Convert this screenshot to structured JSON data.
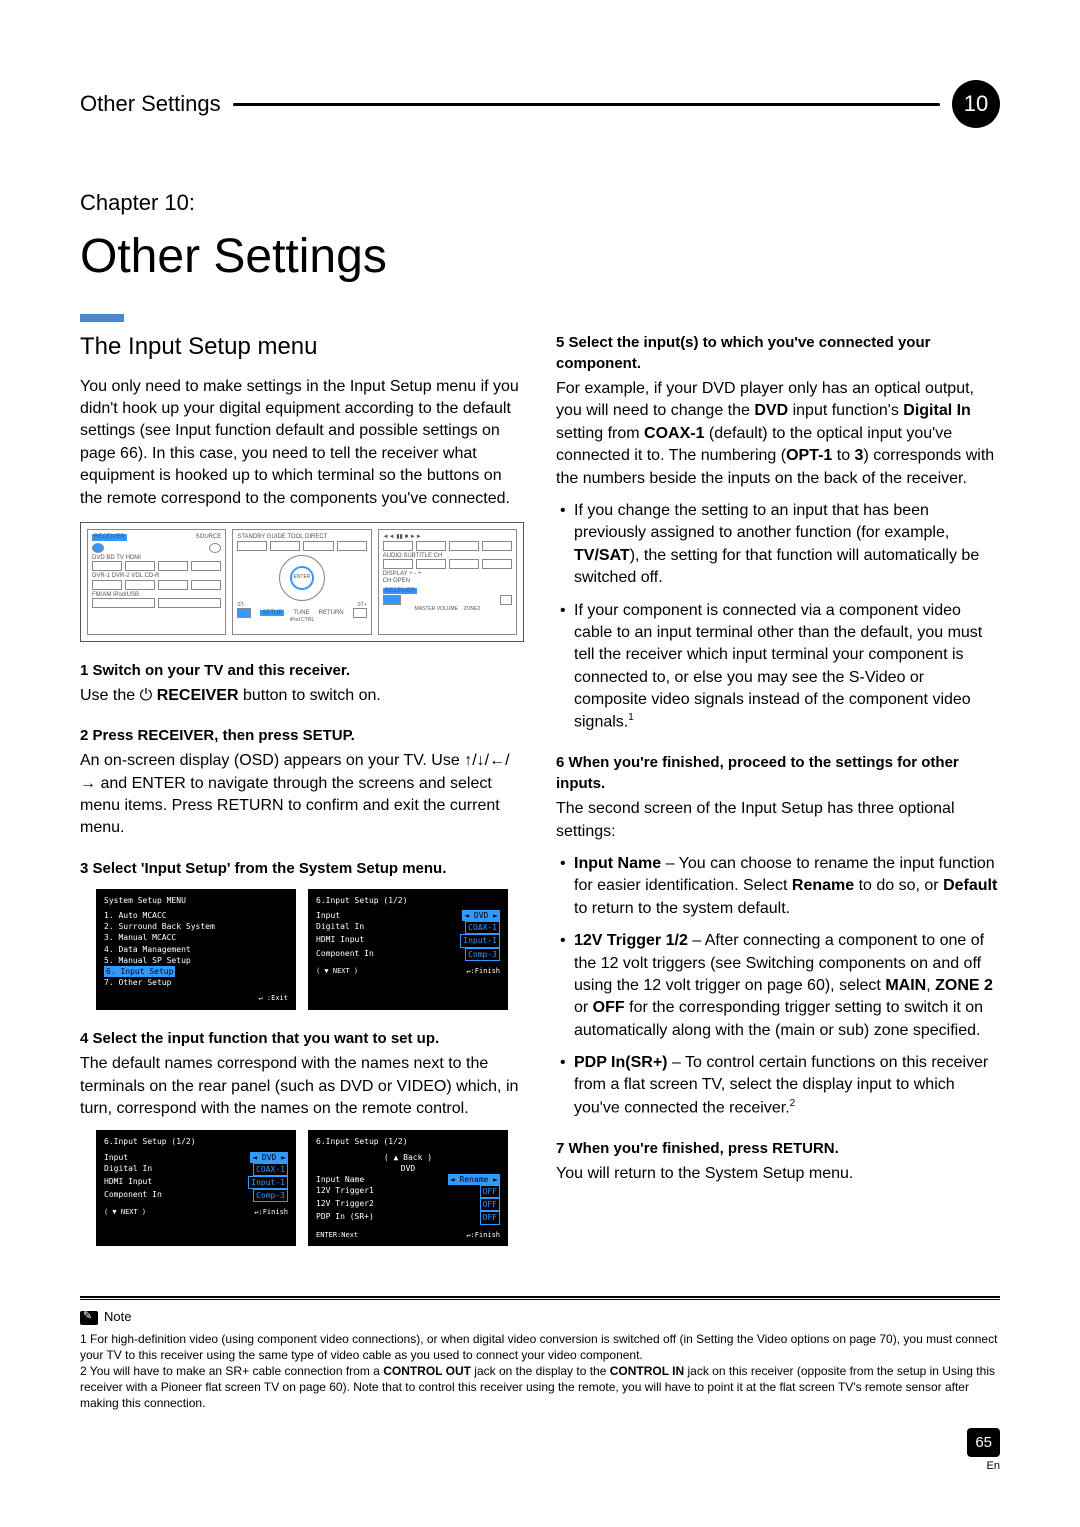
{
  "header": {
    "title": "Other Settings",
    "badge": "10"
  },
  "chapter": "Chapter 10:",
  "pageTitle": "Other Settings",
  "sectionTitle": "The Input Setup menu",
  "leftIntro": "You only need to make settings in the Input Setup menu if you didn't hook up your digital equipment according to the default settings (see Input function default and possible settings on page 66). In this case, you need to tell the receiver what equipment is hooked up to which terminal so the buttons on the remote correspond to the components you've connected.",
  "remoteLabels": {
    "p1a": "RECEIVER",
    "p1b": "SOURCE",
    "rowDVD": "DVD BD TV HDMI",
    "rowDVR": "DVR-1 DVR-2 VDL CD-R",
    "rowFM": "FM/AM iPod/USB",
    "p2a": "STANDBY GUIDE TOOL DIRECT",
    "p2b": "MENU/ENTER",
    "setup": "SETUP",
    "return": "RETURN",
    "tune": "TUNE",
    "p3a": "◄◄  ▮▮  ■  ►►",
    "p3b": "AUDIO SUBTITLE CH",
    "p3c": "DISPLAY  +  -  +",
    "p3d": "CH OPEN",
    "receiver": "RECEIVER",
    "zone": "ZONE2"
  },
  "step1": {
    "head": "1   Switch on your TV and this receiver.",
    "body_pre": "Use the ",
    "sym": "⏻",
    "btn": "RECEIVER",
    "body_post": " button to switch on."
  },
  "step2": {
    "head_a": "2   Press ",
    "head_b": "RECEIVER",
    "head_c": ", then press ",
    "head_d": "SETUP",
    "head_e": ".",
    "body": "An on-screen display (OSD) appears on your TV. Use ↑/↓/←/→ and ENTER to navigate through the screens and select menu items. Press RETURN to confirm and exit the current menu."
  },
  "step3": {
    "head": "3   Select 'Input Setup' from the System Setup menu."
  },
  "osd1": {
    "title": "System  Setup  MENU",
    "items": [
      "1. Auto  MCACC",
      "2. Surround  Back  System",
      "3. Manual  MCACC",
      "4. Data  Management",
      "5. Manual  SP  Setup",
      "6. Input  Setup",
      "7. Other  Setup"
    ],
    "hiIndex": 5,
    "foot_r": "↵ :Exit"
  },
  "osd2": {
    "title": "6.Input  Setup              (1/2)",
    "rows": [
      [
        "Input",
        "DVD",
        true
      ],
      [
        "Digital In",
        "COAX-1",
        false
      ],
      [
        "HDMI Input",
        "Input-1",
        false
      ],
      [
        "Component In",
        "Comp-3",
        false
      ]
    ],
    "foot_l": "( ▼ NEXT )",
    "foot_r": "↵:Finish"
  },
  "step4": {
    "head": "4   Select the input function that you want to set up.",
    "body": "The default names correspond with the names next to the terminals on the rear panel (such as DVD or VIDEO) which, in turn, correspond with the names on the remote control."
  },
  "osd3": {
    "title": "6.Input  Setup              (1/2)",
    "rows": [
      [
        "Input",
        "DVD",
        true
      ],
      [
        "Digital In",
        "COAX-1",
        false
      ],
      [
        "HDMI Input",
        "Input-1",
        false
      ],
      [
        "Component In",
        "Comp-3",
        false
      ]
    ],
    "foot_l": "( ▼ NEXT )",
    "foot_r": "↵:Finish"
  },
  "osd4": {
    "title": "6.Input  Setup              (1/2)",
    "back": "( ▲  Back  )",
    "sub": "DVD",
    "rows": [
      [
        "Input  Name",
        "Rename",
        true
      ],
      [
        "12V  Trigger1",
        "OFF",
        false
      ],
      [
        "12V  Trigger2",
        "OFF",
        false
      ],
      [
        "PDP  In (SR+)",
        "OFF",
        false
      ]
    ],
    "foot_l": "ENTER:Next",
    "foot_r": "↵:Finish"
  },
  "step5": {
    "head": "5   Select the input(s) to which you've connected your component.",
    "body1_a": "For example, if your DVD player only has an optical output, you will need to change the ",
    "body1_b": "DVD",
    "body1_c": " input function's ",
    "body1_d": "Digital In",
    "body1_e": " setting from ",
    "body1_f": "COAX-1",
    "body1_g": " (default) to the optical input you've connected it to. The numbering (",
    "body1_h": "OPT-1",
    "body1_i": " to ",
    "body1_j": "3",
    "body1_k": ") corresponds with the numbers beside the inputs on the back of the receiver.",
    "bullet1_a": "If you change the setting to an input that has been previously assigned to another function (for example, ",
    "bullet1_b": "TV/SAT",
    "bullet1_c": "), the setting for that function will automatically be switched off.",
    "bullet2": "If your component is connected via a component video cable to an input terminal other than the default, you must tell the receiver which input terminal your component is connected to, or else you may see the S-Video or composite video signals instead of the component video signals."
  },
  "step6": {
    "head": "6   When you're finished, proceed to the settings for other inputs.",
    "intro": "The second screen of the Input Setup has three optional settings:",
    "iname_a": "Input Name",
    "iname_b": " – You can choose to rename the input function for easier identification. Select ",
    "iname_c": "Rename",
    "iname_d": " to do so, or ",
    "iname_e": "Default",
    "iname_f": " to return to the system default.",
    "trig_a": "12V Trigger 1/2",
    "trig_b": " – After connecting a component to one of the 12 volt triggers (see Switching components on and off using the 12 volt trigger on page 60), select ",
    "trig_c": "MAIN",
    "trig_d": ", ",
    "trig_e": "ZONE 2",
    "trig_f": " or ",
    "trig_g": "OFF",
    "trig_h": " for the corresponding trigger setting to switch it on automatically along with the (main or sub) zone specified.",
    "pdp_a": "PDP In(SR+)",
    "pdp_b": " – To control certain functions on this receiver from a flat screen TV, select the display input to which you've connected the receiver."
  },
  "step7": {
    "head_a": "7   When you're finished, press ",
    "head_b": "RETURN",
    "head_c": ".",
    "body": "You will return to the System Setup menu."
  },
  "sup1": "1",
  "sup2": "2",
  "noteLabel": "Note",
  "fn1": "1 For high-definition video (using component video connections), or when digital video conversion is switched off (in Setting the Video options on page 70), you must connect your TV to this receiver using the same type of video cable as you used to connect your video component.",
  "fn2_a": "2 You will have to make an SR+ cable connection from a ",
  "fn2_b": "CONTROL OUT",
  "fn2_c": " jack on the display to the ",
  "fn2_d": "CONTROL IN",
  "fn2_e": " jack on this receiver (opposite from the setup in Using this receiver with a Pioneer flat screen TV on page 60). Note that to control this receiver using the remote, you will have to point it at the flat screen TV's remote sensor after making this connection.",
  "pageNum": "65",
  "pageLang": "En"
}
